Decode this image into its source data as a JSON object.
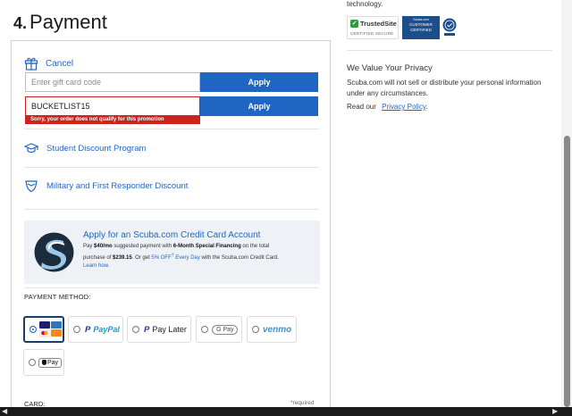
{
  "step": {
    "number": "4.",
    "title": "Payment"
  },
  "gift": {
    "cancel_label": "Cancel",
    "gift_placeholder": "Enter gift card code",
    "apply_label": "Apply",
    "promo_value": "BUCKETLIST15",
    "promo_apply_label": "Apply",
    "error": "Sorry, your order does not qualify for this promotion"
  },
  "options": {
    "student": "Student Discount Program",
    "military": "Military and First Responder Discount"
  },
  "credit_card_promo": {
    "title": "Apply for an Scuba.com Credit Card Account",
    "line1_pre": "Pay ",
    "line1_amount": "$40/mo",
    "line1_mid": " suggested payment with ",
    "line1_bold": "6-Month Special Financing",
    "line1_post": " on the total",
    "line2_pre": "purchase of ",
    "line2_amount": "$239.15",
    "line2_mid": ". Or get ",
    "line2_blue": "5% OFF",
    "line2_sup": "†",
    "line2_blue2": " Every Day",
    "line2_post": " with the Scuba.com Credit Card.",
    "learn_more": "Learn how."
  },
  "payment_method": {
    "label": "PAYMENT METHOD:",
    "paypal": "PayPal",
    "pay_later": "Pay Later",
    "gpay": "G Pay",
    "venmo": "venmo",
    "apple_pay": "Pay"
  },
  "card": {
    "label": "CARD:",
    "required": "*required"
  },
  "sidebar": {
    "tech_text": "technology.",
    "trustedsite_name": "TrustedSite",
    "trustedsite_sub": "CERTIFIED SECURE",
    "customer_badge_top": "Scuba.com",
    "customer_badge_line1": "CUSTOMER",
    "customer_badge_line2": "CERTIFIED",
    "privacy_title": "We Value Your Privacy",
    "privacy_body": "Scuba.com will not sell or distribute your personal information under any circumstances.",
    "privacy_read": "Read our",
    "privacy_link": "Privacy Policy",
    "privacy_period": "."
  },
  "colors": {
    "accent": "#1f66c4",
    "error": "#d02020",
    "selected_border": "#1a3f66",
    "promo_bg": "#eef2f6"
  }
}
